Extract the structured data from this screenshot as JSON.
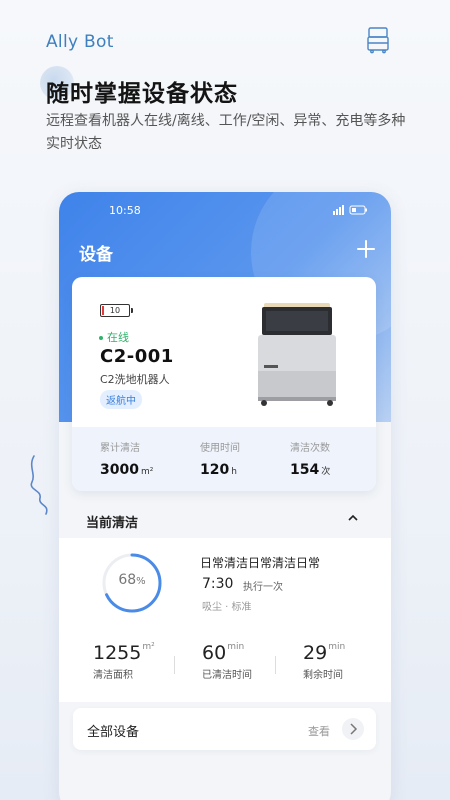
{
  "brand": "Ally Bot",
  "headline": "随时掌握设备状态",
  "subline": "远程查看机器人在线/离线、工作/空闲、异常、充电等多种实时状态",
  "phone": {
    "status_time": "10:58",
    "title": "设备",
    "device": {
      "battery": "10",
      "status": "在线",
      "id": "C2-001",
      "type": "C2洗地机器人",
      "badge": "返航中"
    },
    "stats": [
      {
        "label": "累计清洁",
        "value": "3000",
        "unit": "m²"
      },
      {
        "label": "使用时间",
        "value": "120",
        "unit": "h"
      },
      {
        "label": "清洁次数",
        "value": "154",
        "unit": "次"
      }
    ],
    "current": {
      "title": "当前清洁",
      "progress_text": "68",
      "progress_unit": "%",
      "progress_value": 68,
      "task_name": "日常清洁日常清洁日常",
      "time": "7:30",
      "repeat": "执行一次",
      "mode": "吸尘 · 标准",
      "metrics": [
        {
          "value": "1255",
          "unit": "m²",
          "label": "清洁面积"
        },
        {
          "value": "60",
          "unit": "min",
          "label": "已清洁时间"
        },
        {
          "value": "29",
          "unit": "min",
          "label": "剩余时间"
        }
      ]
    },
    "all_devices": {
      "label": "全部设备",
      "action": "查看"
    }
  },
  "colors": {
    "accent": "#3f83ea",
    "online": "#2fb36a",
    "battery_low": "#e23b3b"
  }
}
